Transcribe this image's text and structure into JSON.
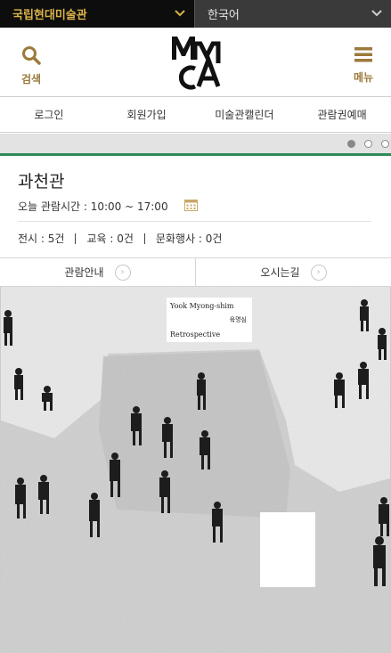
{
  "topbar": {
    "museum_select": "국립현대미술관",
    "language_select": "한국어"
  },
  "header": {
    "search_label": "검색",
    "menu_label": "메뉴",
    "logo_letters": "MMCA"
  },
  "nav": {
    "items": [
      "로그인",
      "회원가입",
      "미술관캘린더",
      "관람권예매"
    ]
  },
  "slider": {
    "total": 3,
    "active_index": 0
  },
  "venue": {
    "name": "과천관",
    "hours": "오늘 관람시간 : 10:00 ~ 17:00",
    "counts": [
      "전시 : 5건",
      "교육 : 0건",
      "문화행사 : 0건"
    ]
  },
  "actions": {
    "guide_label": "관람안내",
    "directions_label": "오시는길"
  },
  "banner": {
    "title_en": "Yook Myong-shim",
    "title_ko": "육명심",
    "subtitle": "Retrospective"
  },
  "colors": {
    "accent_gold": "#9b7a3a",
    "select_gold": "#d9b24a",
    "accent_green": "#2e8b57"
  }
}
